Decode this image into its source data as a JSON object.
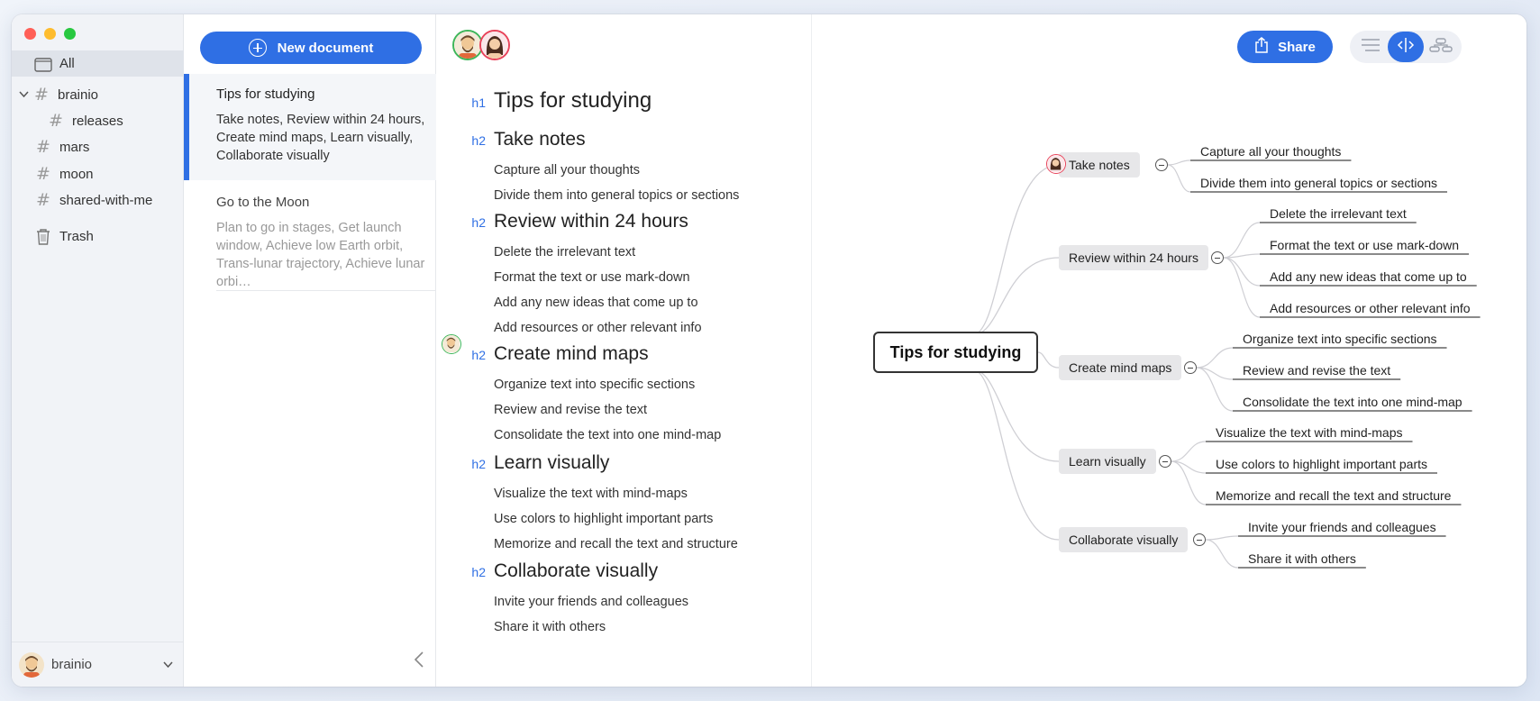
{
  "sidebar": {
    "items": [
      {
        "label": "All",
        "icon": "folder-icon"
      },
      {
        "label": "brainio",
        "icon": "hash-icon"
      },
      {
        "label": "releases",
        "icon": "hash-icon"
      },
      {
        "label": "mars",
        "icon": "hash-icon"
      },
      {
        "label": "moon",
        "icon": "hash-icon"
      },
      {
        "label": "shared-with-me",
        "icon": "hash-icon"
      },
      {
        "label": "Trash",
        "icon": "trash-icon"
      }
    ],
    "user": "brainio"
  },
  "doclist": {
    "new_document_label": "New document",
    "docs": [
      {
        "title": "Tips for studying",
        "preview": "Take notes, Review within 24 hours, Create mind maps, Learn visually, Collaborate visually"
      },
      {
        "title": "Go to the Moon",
        "preview": "Plan to go in stages, Get launch window, Achieve low Earth orbit, Trans-lunar trajectory, Achieve lunar orbi…"
      }
    ]
  },
  "editor": {
    "h1": {
      "tag": "h1",
      "text": "Tips for studying"
    },
    "sections": [
      {
        "tag": "h2",
        "text": "Take notes",
        "items": [
          "Capture all your thoughts",
          "Divide them into general topics or sections"
        ]
      },
      {
        "tag": "h2",
        "text": "Review within 24 hours",
        "items": [
          "Delete the irrelevant text",
          "Format the text or use mark-down",
          "Add any new ideas that come up to",
          "Add resources or other relevant info"
        ]
      },
      {
        "tag": "h2",
        "text": "Create mind maps",
        "items": [
          "Organize text into specific sections",
          "Review and revise the text",
          "Consolidate the text into one mind-map"
        ]
      },
      {
        "tag": "h2",
        "text": "Learn visually",
        "items": [
          "Visualize the text with mind-maps",
          "Use colors to highlight important parts",
          "Memorize and recall the text and structure"
        ]
      },
      {
        "tag": "h2",
        "text": "Collaborate visually",
        "items": [
          "Invite your friends and colleagues",
          "Share it with others"
        ]
      }
    ]
  },
  "mindmap": {
    "share_label": "Share",
    "root": "Tips for studying",
    "branches": [
      {
        "label": "Take notes",
        "leaves": [
          "Capture all your thoughts",
          "Divide them into general topics or sections"
        ]
      },
      {
        "label": "Review within 24 hours",
        "leaves": [
          "Delete the irrelevant text",
          "Format the text or use mark-down",
          "Add any new ideas that come up to",
          "Add resources or other relevant info"
        ]
      },
      {
        "label": "Create mind maps",
        "leaves": [
          "Organize text into specific sections",
          "Review and revise the text",
          "Consolidate the text into one mind-map"
        ]
      },
      {
        "label": "Learn visually",
        "leaves": [
          "Visualize the text with mind-maps",
          "Use colors to highlight important parts",
          "Memorize and recall the text and structure"
        ]
      },
      {
        "label": "Collaborate visually",
        "leaves": [
          "Invite your friends and colleagues",
          "Share it with others"
        ]
      }
    ]
  },
  "colors": {
    "accent": "#2f6fe4",
    "green_ring": "#3eb65a",
    "red_ring": "#e8435a"
  }
}
